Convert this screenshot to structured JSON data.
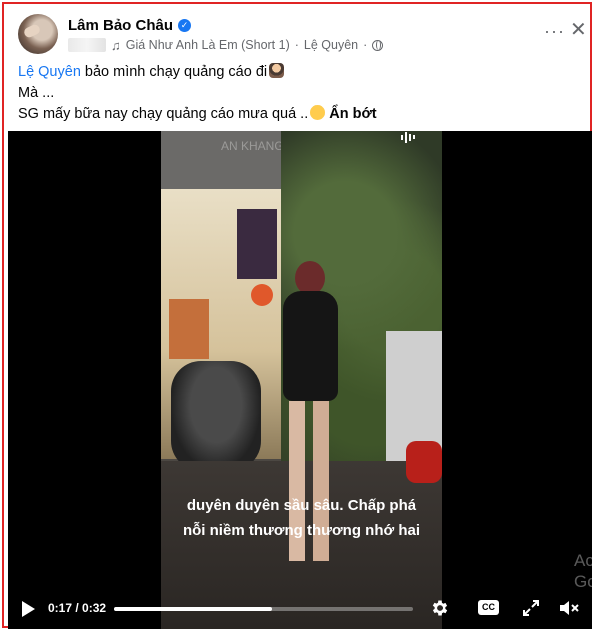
{
  "post": {
    "author": "Lâm Bảo Châu",
    "song": "Giá Như Anh Là Em (Short 1)",
    "song_artist": "Lệ Quyên",
    "separator": "·",
    "icons": [
      "avatar",
      "verified-badge",
      "music-note-icon",
      "globe-icon",
      "more-options-icon",
      "close-icon"
    ]
  },
  "content": {
    "line1_mention": "Lệ Quyên",
    "line1_rest": " bảo mình chạy quảng cáo đi",
    "line2": " Mà ...",
    "line3": "SG mấy bữa nay chạy quảng cáo mưa quá ..",
    "see_less": "Ẩn bớt"
  },
  "video": {
    "subtitle_line1": "duyên duyên sầu sâu. Chấp phá",
    "subtitle_line2": "nỗi niềm thương thương nhớ hai",
    "side_text": "Ac\nGo",
    "current_time": "0:17",
    "time_separator": " / ",
    "duration": "0:32",
    "progress_fraction": 0.53,
    "cc_label": "CC",
    "control_icons": [
      "play-icon",
      "settings-gear-icon",
      "cc-icon",
      "fullscreen-icon",
      "mute-icon"
    ]
  },
  "colors": {
    "accent": "#1877f2",
    "frame_border": "#e02424",
    "meta_text": "#65676b"
  }
}
